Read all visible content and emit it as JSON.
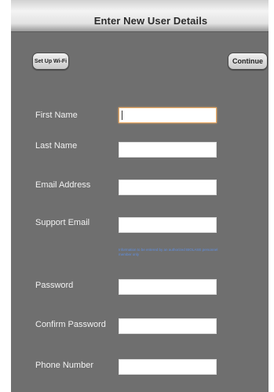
{
  "header": {
    "title": "Enter New User Details"
  },
  "buttons": {
    "wifi_label": "Set Up Wi-Fi",
    "continue_label": "Continue"
  },
  "form": {
    "first_name_label": "First Name",
    "last_name_label": "Last Name",
    "email_label": "Email Address",
    "support_email_label": "Support Email",
    "support_email_note": "Information to be entered by an authorized BIOLASE personnel member only",
    "password_label": "Password",
    "confirm_password_label": "Confirm Password",
    "phone_label": "Phone Number"
  }
}
